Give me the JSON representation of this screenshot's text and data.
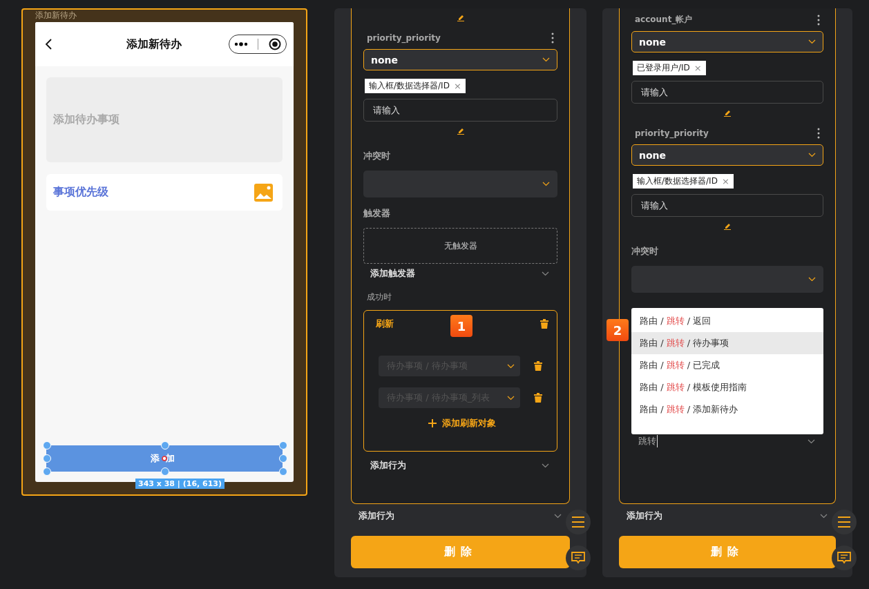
{
  "preview": {
    "frame_label": "添加新待办",
    "nav_title": "添加新待办",
    "textarea_placeholder": "添加待办事项",
    "priority_label": "事项优先级",
    "button_label": "添加",
    "selection_size": "343 x 38 | (16, 613)"
  },
  "panels": [
    {
      "items": [
        {
          "kind": "pencil"
        },
        {
          "kind": "field",
          "name": "priority_priority",
          "value": "none",
          "tag": "输入框/数据选择器/ID",
          "tag_close": "×",
          "placeholder": "请输入"
        },
        {
          "kind": "pencil"
        },
        {
          "kind": "label",
          "text": "冲突时"
        },
        {
          "kind": "select"
        },
        {
          "kind": "label",
          "text": "触发器"
        },
        {
          "kind": "empty_box",
          "text": "无触发器"
        },
        {
          "kind": "expander",
          "text": "添加触发器"
        },
        {
          "kind": "sublabel",
          "text": "成功时"
        },
        {
          "kind": "action",
          "title": "刷新",
          "badge": "1",
          "targets": [
            "待办事项 / 待办事项",
            "待办事项 / 待办事项_列表"
          ],
          "add_label": "添加刷新对象"
        },
        {
          "kind": "expander",
          "text": "添加行为"
        }
      ],
      "after_card": "添加行为",
      "delete_label": "删除"
    },
    {
      "items": [
        {
          "kind": "field",
          "name": "account_帐户",
          "value": "none",
          "tag": "已登录用户/ID",
          "tag_close": "×",
          "placeholder": "请输入"
        },
        {
          "kind": "pencil"
        },
        {
          "kind": "field",
          "name": "priority_priority",
          "value": "none",
          "tag": "输入框/数据选择器/ID",
          "tag_close": "×",
          "placeholder": "请输入"
        },
        {
          "kind": "pencil"
        },
        {
          "kind": "label",
          "text": "冲突时"
        },
        {
          "kind": "select"
        },
        {
          "kind": "menu",
          "badge": "2",
          "options": [
            {
              "selected": false,
              "parts": [
                {
                  "text": "路由 / ",
                  "match": false
                },
                {
                  "text": "跳转",
                  "match": true
                },
                {
                  "text": " / 返回",
                  "match": false
                }
              ]
            },
            {
              "selected": true,
              "parts": [
                {
                  "text": "路由 / ",
                  "match": false
                },
                {
                  "text": "跳转",
                  "match": true
                },
                {
                  "text": " / 待办事项",
                  "match": false
                }
              ]
            },
            {
              "selected": false,
              "parts": [
                {
                  "text": "路由 / ",
                  "match": false
                },
                {
                  "text": "跳转",
                  "match": true
                },
                {
                  "text": " / 已完成",
                  "match": false
                }
              ]
            },
            {
              "selected": false,
              "parts": [
                {
                  "text": "路由 / ",
                  "match": false
                },
                {
                  "text": "跳转",
                  "match": true
                },
                {
                  "text": " / 模板使用指南",
                  "match": false
                }
              ]
            },
            {
              "selected": false,
              "parts": [
                {
                  "text": "路由 / ",
                  "match": false
                },
                {
                  "text": "跳转",
                  "match": true
                },
                {
                  "text": " / 添加新待办",
                  "match": false
                }
              ]
            }
          ]
        },
        {
          "kind": "search",
          "value": "跳转"
        }
      ],
      "after_card": "添加行为",
      "delete_label": "删除"
    }
  ]
}
